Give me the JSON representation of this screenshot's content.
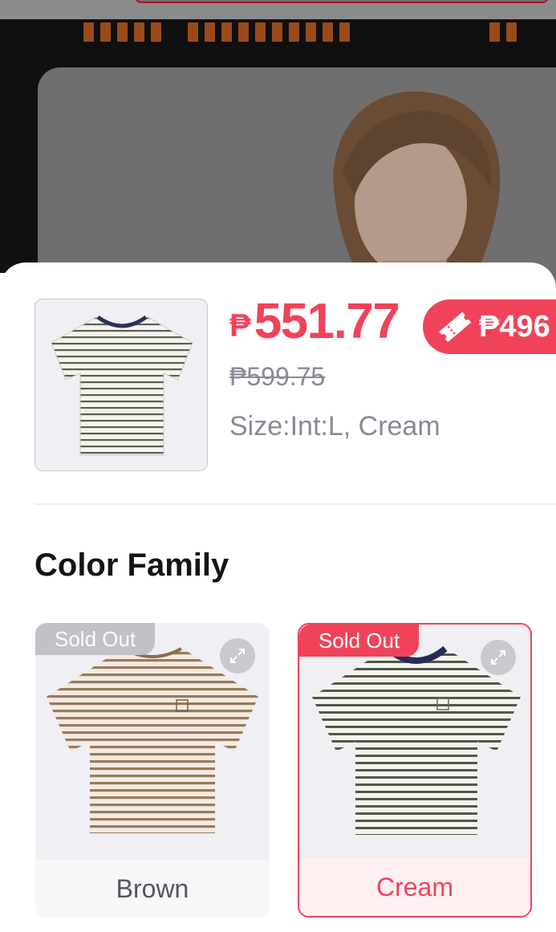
{
  "product": {
    "currency_symbol": "₱",
    "price": "551.77",
    "voucher_price": "₱496",
    "original_price": "₱599.75",
    "selected_variant": "Size:Int:L, Cream",
    "thumbnail_icon": "striped-tshirt-icon"
  },
  "color_section": {
    "title": "Color Family",
    "options": [
      {
        "label": "Brown",
        "badge": "Sold Out",
        "selected": false,
        "stripe_color": "#9a7a5a"
      },
      {
        "label": "Cream",
        "badge": "Sold Out",
        "selected": true,
        "stripe_color": "#54564e"
      }
    ]
  },
  "colors": {
    "accent": "#f0435a",
    "muted_text": "#8a8a96",
    "backdrop": "#101010"
  }
}
